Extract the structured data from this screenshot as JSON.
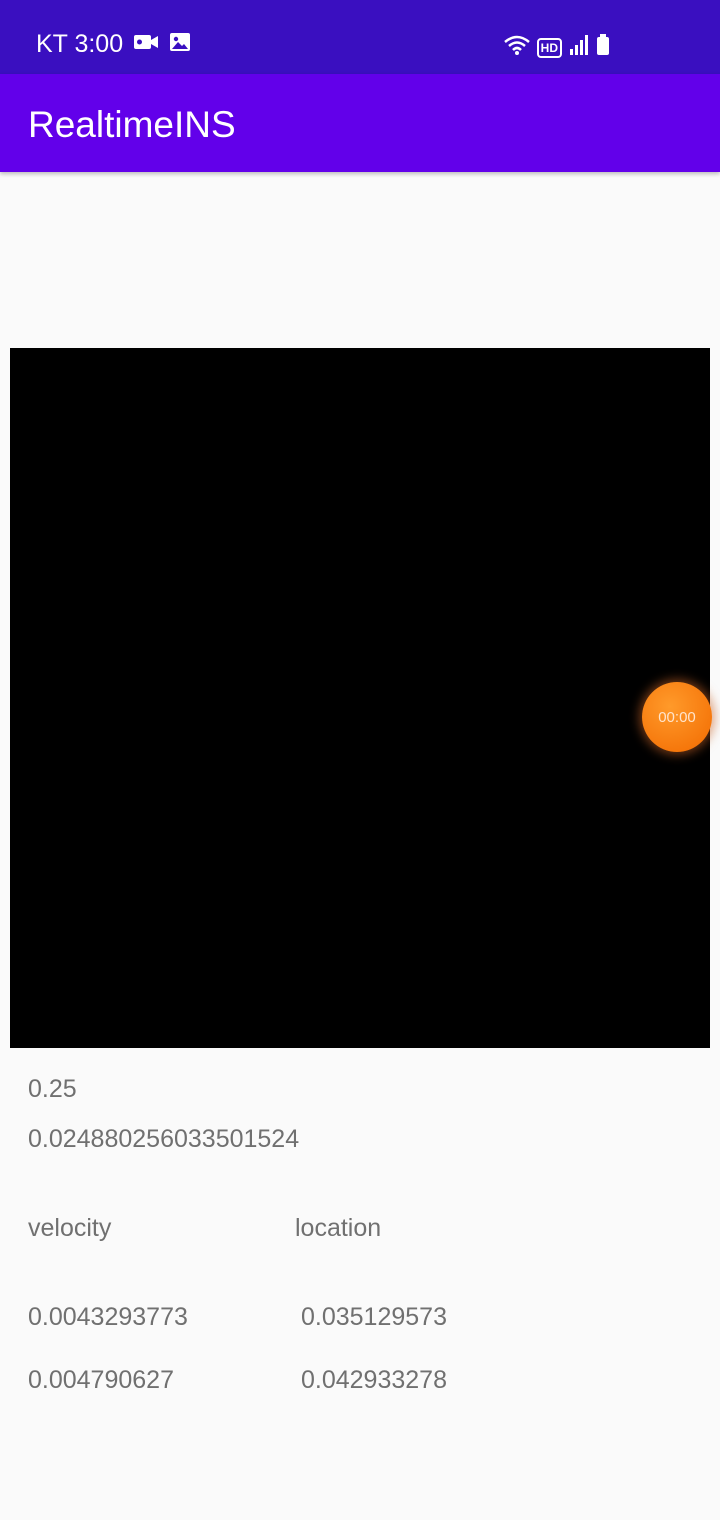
{
  "status_bar": {
    "carrier_time": "KT 3:00",
    "network_badge": "HD",
    "icons": [
      "video-camera-icon",
      "image-icon",
      "wifi-icon",
      "hd-badge-icon",
      "signal-icon",
      "battery-icon"
    ]
  },
  "app_bar": {
    "title": "RealtimeINS"
  },
  "recorder": {
    "timer": "00:00"
  },
  "readings": {
    "value_1": "0.25",
    "value_2": "0.024880256033501524"
  },
  "table": {
    "headers": {
      "velocity": "velocity",
      "location": "location"
    },
    "rows": [
      {
        "velocity": "0.0043293773",
        "location": "0.035129573"
      },
      {
        "velocity": "0.004790627",
        "location": "0.042933278"
      }
    ]
  },
  "colors": {
    "status_bar": "#3a0fc0",
    "app_bar": "#6200ea",
    "fab": "#f57c00",
    "text": "#707070"
  }
}
